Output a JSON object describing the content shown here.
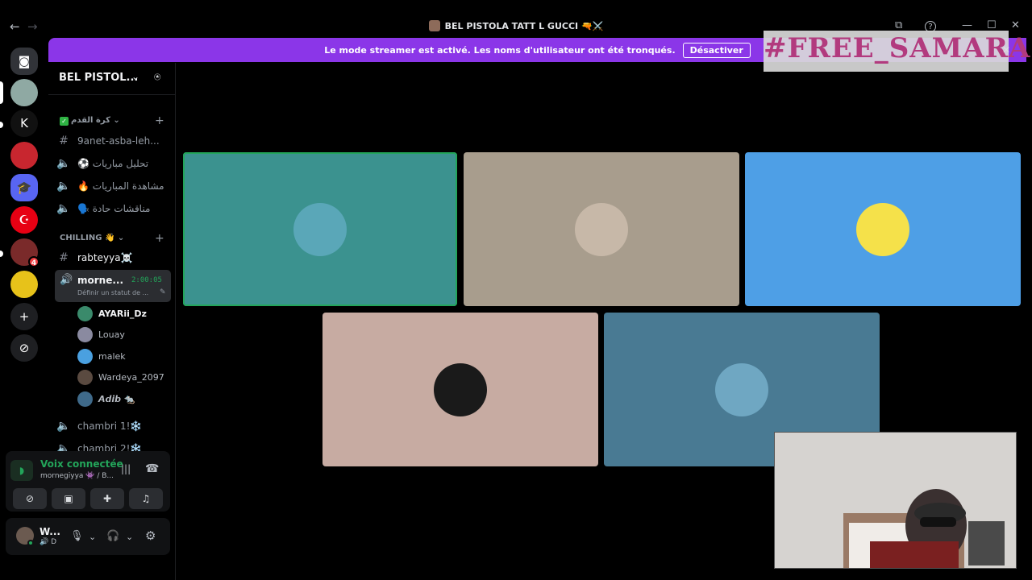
{
  "window": {
    "title": "BEL PISTOLA TATT L GUCCI 🔫⚔️",
    "back_glyph": "←",
    "forward_glyph": "→",
    "inbox_glyph": "⧉",
    "help_glyph": "?",
    "minimize_glyph": "—",
    "maximize_glyph": "☐",
    "close_glyph": "✕"
  },
  "banner": {
    "message": "Le mode streamer est activé. Les noms d'utilisateur ont été tronqués.",
    "button_label": "Désactiver",
    "color": "#8b36e8"
  },
  "overlay": {
    "hashtag": "#FREE_SAMARA",
    "close_glyph": "✕"
  },
  "rail": {
    "servers": [
      {
        "name": "discord-home",
        "glyph": "◙",
        "color": "#313338"
      },
      {
        "name": "server-1",
        "glyph": "",
        "color": "#8fa9a3"
      },
      {
        "name": "server-2",
        "glyph": "K",
        "color": "#111111"
      },
      {
        "name": "server-3",
        "glyph": "",
        "color": "#c8262f"
      },
      {
        "name": "server-4",
        "glyph": "🎓",
        "color": "#5865f2"
      },
      {
        "name": "server-5",
        "glyph": "☪",
        "color": "#e70013"
      },
      {
        "name": "server-6",
        "glyph": "",
        "color": "#7a2a2a",
        "badge": "4"
      },
      {
        "name": "server-7",
        "glyph": "",
        "color": "#e7c21a"
      },
      {
        "name": "add-server",
        "glyph": "+",
        "color": "#1e1f22"
      },
      {
        "name": "discover",
        "glyph": "⊘",
        "color": "#1e1f22"
      }
    ]
  },
  "sidebar": {
    "guild_name": "BEL PISTOL...",
    "guild_chevron": "⌄",
    "invite_glyph": "⍟",
    "category1": {
      "label": "كرة القدم ⌄",
      "plus": "+"
    },
    "channels1": [
      {
        "type": "text",
        "icon": "#",
        "label": "9anet-asba-leh..."
      },
      {
        "type": "voice",
        "icon": "🔈",
        "label": "⚽ تحليل مباريات"
      },
      {
        "type": "voice",
        "icon": "🔈",
        "label": "🔥 مشاهدة المباريات"
      },
      {
        "type": "voice",
        "icon": "🔈",
        "label": "🗣️ مناقشات حادة"
      }
    ],
    "category2": {
      "label": "CHILLING 👋 ⌄",
      "plus": "+"
    },
    "text_channel": {
      "icon": "#",
      "label": "rabteyya☠️"
    },
    "voice_channel": {
      "icon": "🔊",
      "label": "morne...",
      "timer": "2:00:05",
      "status": "Définir un statut de ...",
      "edit_glyph": "✎"
    },
    "members": [
      {
        "name": "AYARii_Dz",
        "color": "#3a8a6b",
        "bold": true
      },
      {
        "name": "Louay",
        "color": "#8a8aa0",
        "bold": false
      },
      {
        "name": "malek",
        "color": "#4aa0e0",
        "bold": false
      },
      {
        "name": "Wardeya_2097",
        "color": "#5a4a40",
        "bold": false
      },
      {
        "name": "𝘼𝙙𝙞𝙗 🐀",
        "color": "#3f6a8a",
        "bold": false
      }
    ],
    "channels2": [
      {
        "type": "voice",
        "icon": "🔈",
        "label": "chambri 1!❄️"
      },
      {
        "type": "voice",
        "icon": "🔈",
        "label": "chambri 2!❄️"
      }
    ]
  },
  "voice_panel": {
    "status": "Voix connectée",
    "subtitle": "mornegiyya 👾 / B...",
    "signal_glyph": "◗",
    "wave_glyph": "|||",
    "hangup_glyph": "☎",
    "buttons": [
      {
        "name": "camera-off-button",
        "glyph": "⊘"
      },
      {
        "name": "share-screen-button",
        "glyph": "▣"
      },
      {
        "name": "activities-button",
        "glyph": "✚"
      },
      {
        "name": "soundboard-button",
        "glyph": "♫"
      }
    ]
  },
  "user_panel": {
    "name": "W...",
    "sub": "🔊 D",
    "mic_glyph": "🎙",
    "headphones_glyph": "🎧",
    "chevron": "⌄",
    "settings_glyph": "⚙"
  },
  "stage": {
    "tiles": [
      {
        "name": "tile-1",
        "bg": "#3b928f",
        "avatar": "#5aa7b8",
        "speaking": true
      },
      {
        "name": "tile-2",
        "bg": "#a89d8d",
        "avatar": "#c7b8a8",
        "speaking": false
      },
      {
        "name": "tile-3",
        "bg": "#4e9fe6",
        "avatar": "#f5e14a",
        "speaking": false
      },
      {
        "name": "tile-4",
        "bg": "#c7aba2",
        "avatar": "#1a1a1a",
        "speaking": false
      },
      {
        "name": "tile-5",
        "bg": "#497a93",
        "avatar": "#6fa7c2",
        "speaking": false
      }
    ]
  }
}
